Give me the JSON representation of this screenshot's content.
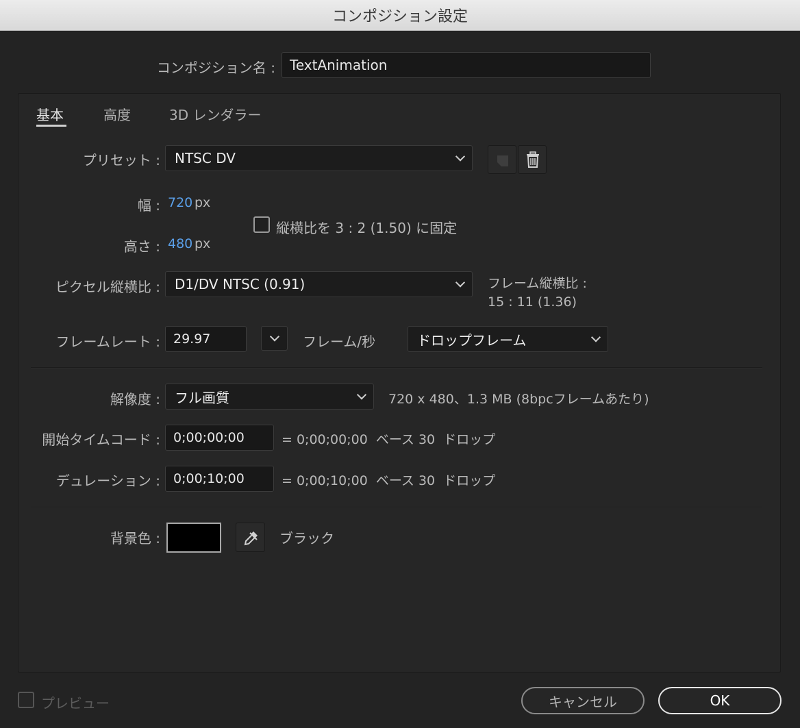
{
  "window": {
    "title": "コンポジション設定"
  },
  "composition_name": {
    "label": "コンポジション名 :",
    "value": "TextAnimation"
  },
  "tabs": [
    {
      "label": "基本",
      "active": true
    },
    {
      "label": "高度",
      "active": false
    },
    {
      "label": "3D レンダラー",
      "active": false
    }
  ],
  "preset": {
    "label": "プリセット :",
    "value": "NTSC DV"
  },
  "width": {
    "label": "幅 :",
    "value": "720",
    "unit": "px"
  },
  "height": {
    "label": "高さ :",
    "value": "480",
    "unit": "px"
  },
  "lock_aspect": {
    "label": "縦横比を 3 : 2 (1.50) に固定",
    "checked": false
  },
  "pixel_aspect": {
    "label": "ピクセル縦横比 :",
    "value": "D1/DV NTSC (0.91)"
  },
  "frame_aspect": {
    "label": "フレーム縦横比 :",
    "value": "15 : 11 (1.36)"
  },
  "frame_rate": {
    "label": "フレームレート :",
    "value": "29.97",
    "unit": "フレーム/秒",
    "drop": "ドロップフレーム"
  },
  "resolution": {
    "label": "解像度 :",
    "value": "フル画質",
    "info": "720 x 480、1.3 MB (8bpcフレームあたり)"
  },
  "start_timecode": {
    "label": "開始タイムコード :",
    "value": "0;00;00;00",
    "info": "= 0;00;00;00  ベース 30  ドロップ"
  },
  "duration": {
    "label": "デュレーション :",
    "value": "0;00;10;00",
    "info": "= 0;00;10;00  ベース 30  ドロップ"
  },
  "background": {
    "label": "背景色 :",
    "color": "#000000",
    "name": "ブラック"
  },
  "footer": {
    "preview_label": "プレビュー",
    "cancel_label": "キャンセル",
    "ok_label": "OK"
  }
}
